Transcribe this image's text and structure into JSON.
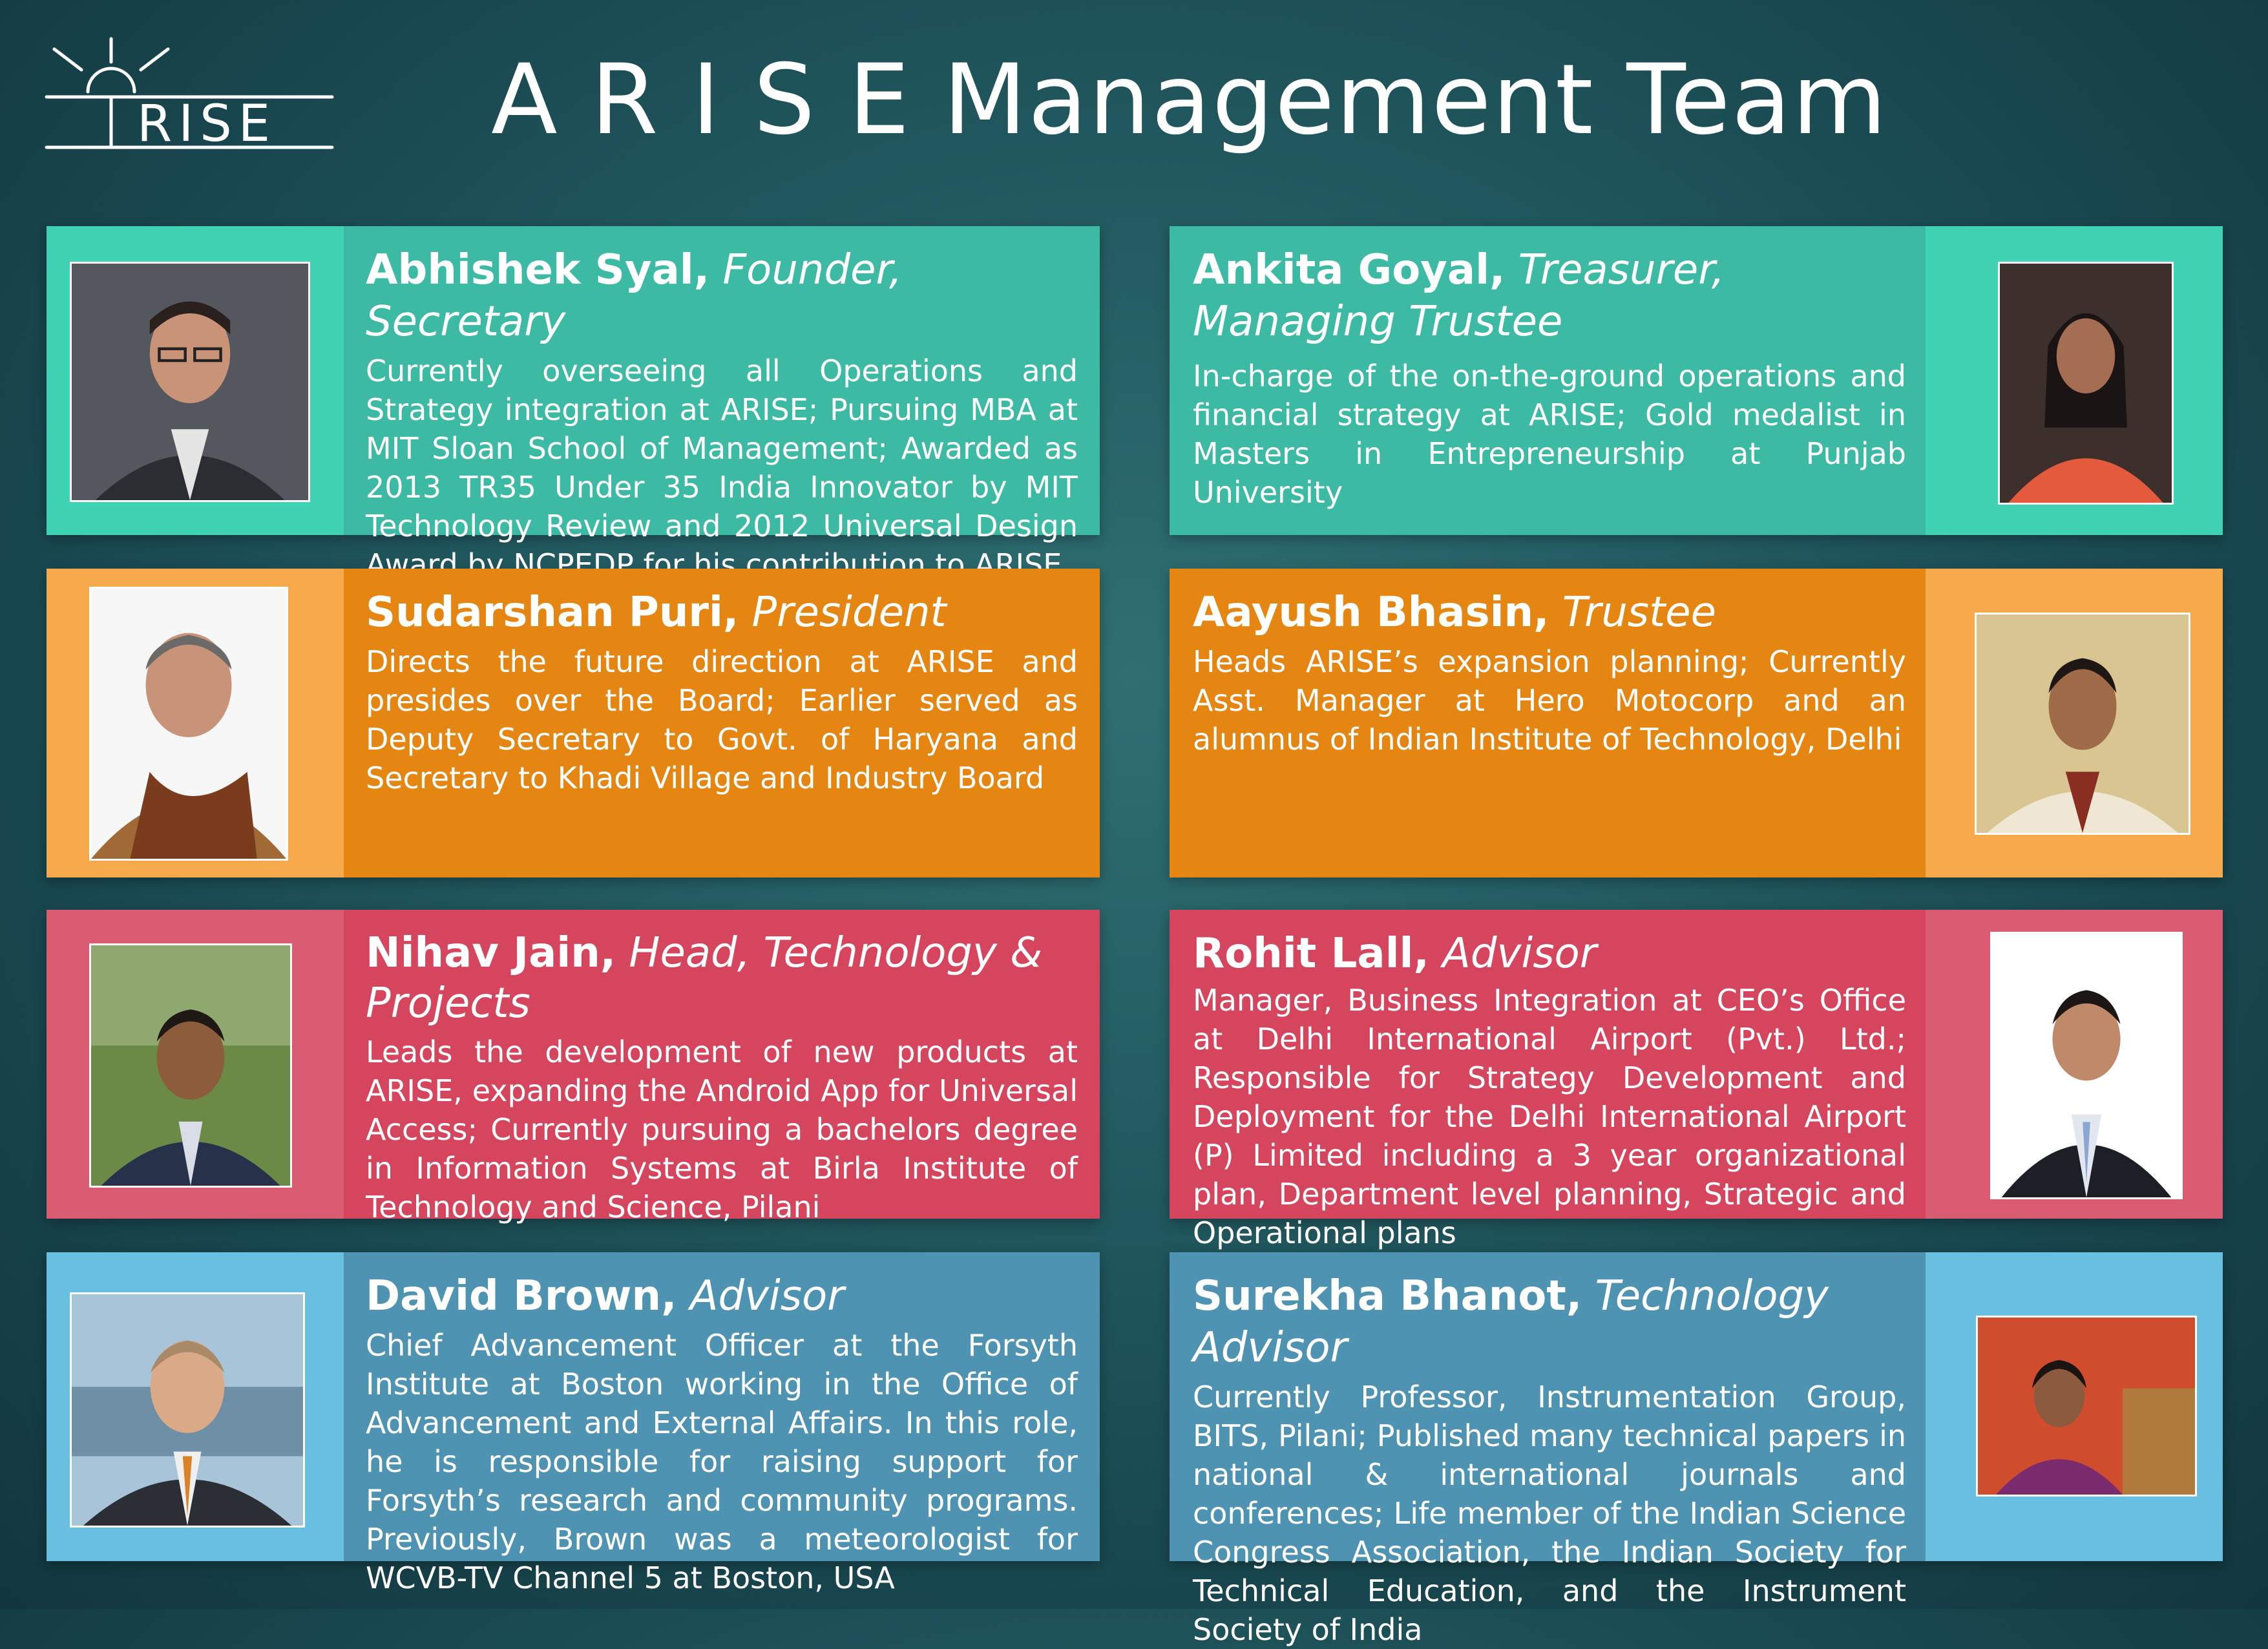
{
  "header": {
    "logo_text": "ARISE",
    "title": "A R I S E Management Team"
  },
  "members": [
    {
      "name": "Abhishek Syal,",
      "role": "Founder, Secretary",
      "bio": "Currently overseeing all Operations and Strategy integration at ARISE; Pursuing MBA at MIT Sloan School of Management; Awarded as 2013 TR35 Under 35 India Innovator by MIT Technology Review and 2012 Universal Design Award by NCPEDP for his contribution to ARISE"
    },
    {
      "name": "Ankita Goyal,",
      "role": "Treasurer, Managing Trustee",
      "bio": "In-charge of the on-the-ground operations and financial strategy at ARISE; Gold medalist in Masters in Entrepreneurship at Punjab University"
    },
    {
      "name": "Sudarshan Puri,",
      "role": "President",
      "bio": "Directs the future direction at ARISE and presides over the Board; Earlier served as Deputy Secretary to Govt. of Haryana and Secretary to Khadi Village and Industry Board"
    },
    {
      "name": "Aayush Bhasin,",
      "role": "Trustee",
      "bio": "Heads ARISE’s expansion planning; Currently Asst. Manager at Hero Motocorp and an alumnus of Indian Institute of Technology, Delhi"
    },
    {
      "name": "Nihav Jain,",
      "role": "Head, Technology & Projects",
      "bio": "Leads the development of new products at ARISE, expanding the Android App for Universal Access; Currently pursuing a bachelors degree in Information Systems at Birla Institute of Technology and Science, Pilani"
    },
    {
      "name": "Rohit Lall,",
      "role": "Advisor",
      "bio": "Manager, Business Integration at CEO’s Office at Delhi International Airport (Pvt.) Ltd.; Responsible for Strategy Development and Deployment for the Delhi International Airport (P) Limited including a 3 year organizational plan, Department level planning, Strategic and Operational plans"
    },
    {
      "name": "David Brown,",
      "role": "Advisor",
      "bio": "Chief Advancement Officer at the Forsyth Institute at Boston working in the Office of Advancement and External Affairs. In this role, he is responsible for raising support for Forsyth’s research and community programs. Previously, Brown was a meteorologist for WCVB-TV Channel 5 at Boston, USA"
    },
    {
      "name": "Surekha Bhanot,",
      "role": "Technology Advisor",
      "bio": "Currently Professor, Instrumentation Group, BITS, Pilani; Published many technical papers in national & international journals and conferences; Life member of the Indian Science Congress Association, the Indian Society for Technical Education, and the Instrument Society of India"
    }
  ]
}
